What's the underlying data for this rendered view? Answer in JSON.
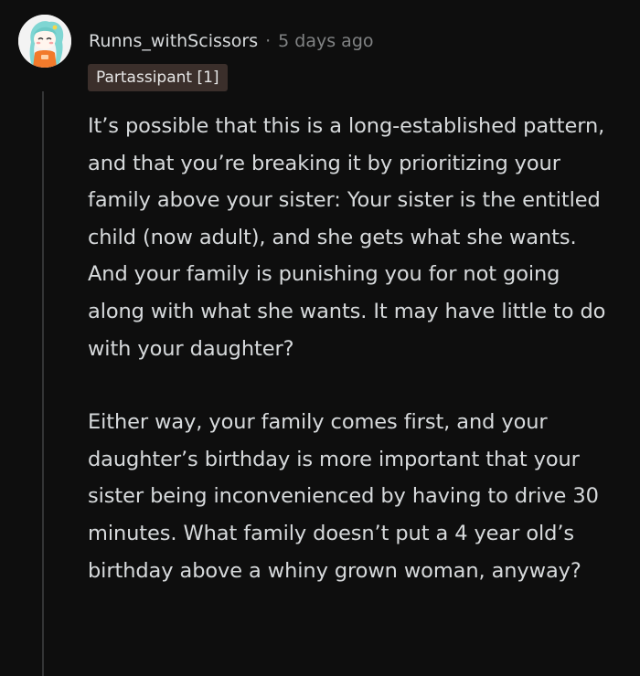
{
  "comment": {
    "author": "Runns_withScissors",
    "separator": "·",
    "timestamp": "5 days ago",
    "flair": "Partassipant [1]",
    "avatar_icon": "snoo-avatar-icon",
    "paragraphs": [
      "It’s possible that this is a long-established pattern, and that you’re breaking it by prioritizing your family above your sister: Your sister is the entitled child (now adult), and she gets what she wants. And your family is punishing you for not going along with what she wants. It may have little to do with your daughter?",
      "Either way, your family comes first, and your daughter’s birthday is more important that your sister being inconvenienced by having to drive 30 minutes. What family doesn’t put a 4 year old’s birthday above a whiny grown woman, anyway?"
    ]
  },
  "colors": {
    "background": "#0e0e0e",
    "text": "#d7dadc",
    "meta": "#818384",
    "flair_bg": "#3b2f2b",
    "thread_line": "#343536"
  }
}
